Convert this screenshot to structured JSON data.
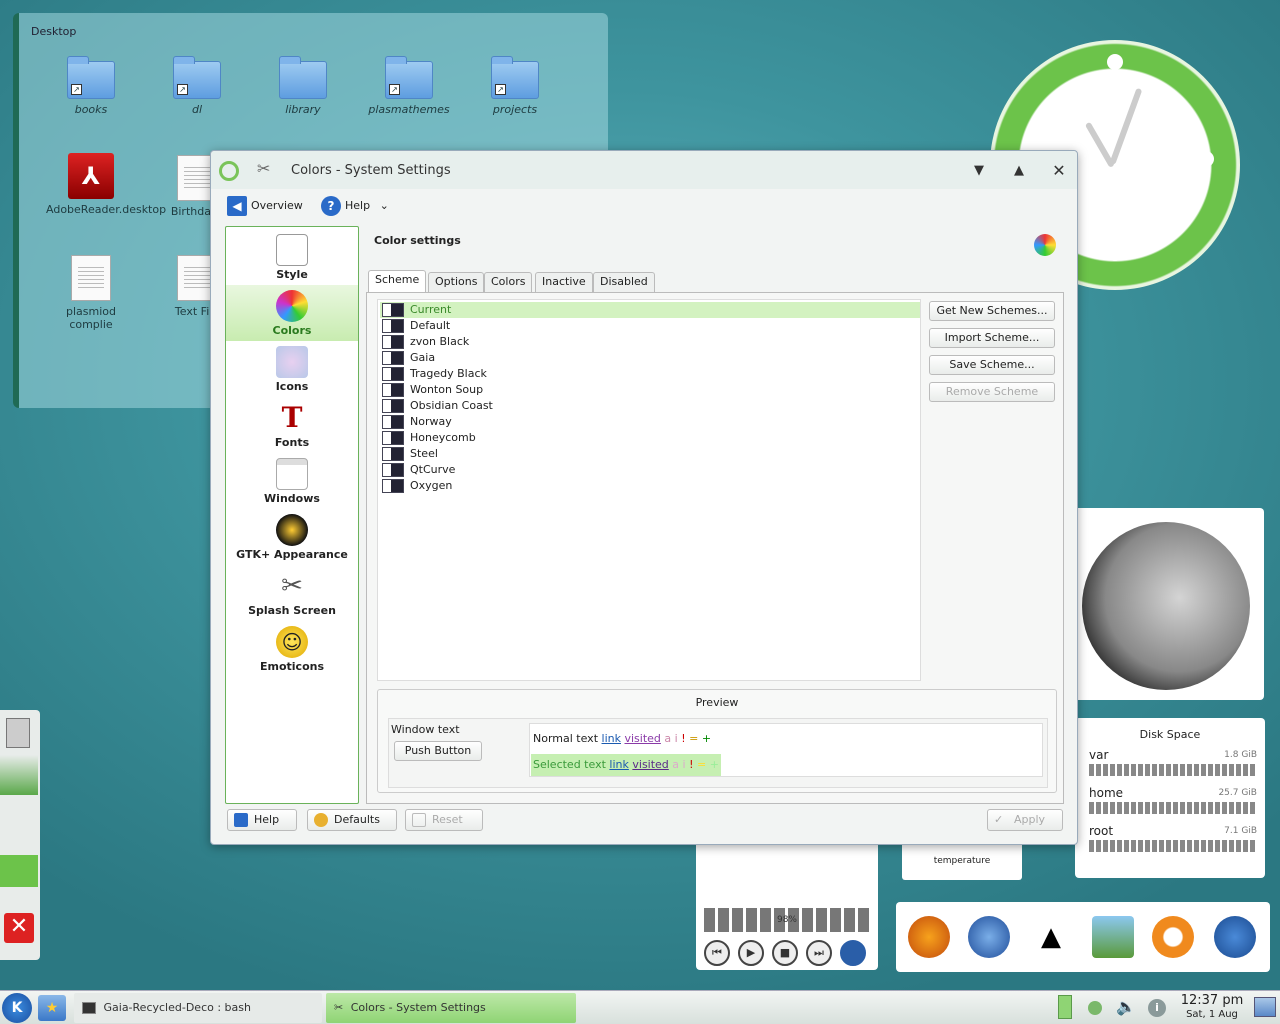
{
  "desktop": {
    "title": "Desktop",
    "icons": [
      {
        "label": "books"
      },
      {
        "label": "dl"
      },
      {
        "label": "library"
      },
      {
        "label": "plasmathemes"
      },
      {
        "label": "projects"
      },
      {
        "label": "AdobeReader.desktop"
      },
      {
        "label": "Birthdays"
      },
      {
        "label": "plasmiod complie"
      },
      {
        "label": "Text File"
      }
    ]
  },
  "dialog": {
    "title": "Colors - System Settings",
    "toolbar": {
      "overview": "Overview",
      "help": "Help"
    },
    "sidebar": [
      {
        "label": "Style"
      },
      {
        "label": "Colors"
      },
      {
        "label": "Icons"
      },
      {
        "label": "Fonts"
      },
      {
        "label": "Windows"
      },
      {
        "label": "GTK+ Appearance"
      },
      {
        "label": "Splash Screen"
      },
      {
        "label": "Emoticons"
      }
    ],
    "content": {
      "heading": "Color settings",
      "tabs": [
        "Scheme",
        "Options",
        "Colors",
        "Inactive",
        "Disabled"
      ],
      "schemes": [
        "Current",
        "Default",
        "zvon Black",
        "Gaia",
        "Tragedy Black",
        "Wonton Soup",
        "Obsidian Coast",
        "Norway",
        "Honeycomb",
        "Steel",
        "QtCurve",
        "Oxygen"
      ],
      "buttons": {
        "get_new": "Get New Schemes...",
        "import": "Import Scheme...",
        "save": "Save Scheme...",
        "remove": "Remove Scheme"
      },
      "preview": {
        "title": "Preview",
        "window_text": "Window text",
        "push_button": "Push Button",
        "normal_text": "Normal text",
        "selected_text": "Selected text",
        "link": "link",
        "visited": "visited",
        "ai": "a i",
        "excl": "!",
        "eq": "=",
        "plus": "+"
      }
    },
    "bottom": {
      "help": "Help",
      "defaults": "Defaults",
      "reset": "Reset",
      "apply": "Apply"
    }
  },
  "widgets": {
    "disk": {
      "title": "Disk Space",
      "rows": [
        {
          "name": "var",
          "size": "1.8 GiB"
        },
        {
          "name": "home",
          "size": "25.7 GiB"
        },
        {
          "name": "root",
          "size": "7.1 GiB"
        }
      ]
    },
    "temperature": "temperature",
    "media_level": "98%",
    "media_controls": [
      "⏮",
      "▶",
      "■",
      "⏭"
    ]
  },
  "taskbar": {
    "k_menu": "K",
    "tasks": [
      "Gaia-Recycled-Deco : bash",
      "Colors - System Settings"
    ],
    "time": "12:37 pm",
    "date": "Sat, 1 Aug"
  },
  "colors": {
    "accent_green": "#6ab25a",
    "selection": "#d3f2c0",
    "desktop_bg": "#3e949e"
  }
}
